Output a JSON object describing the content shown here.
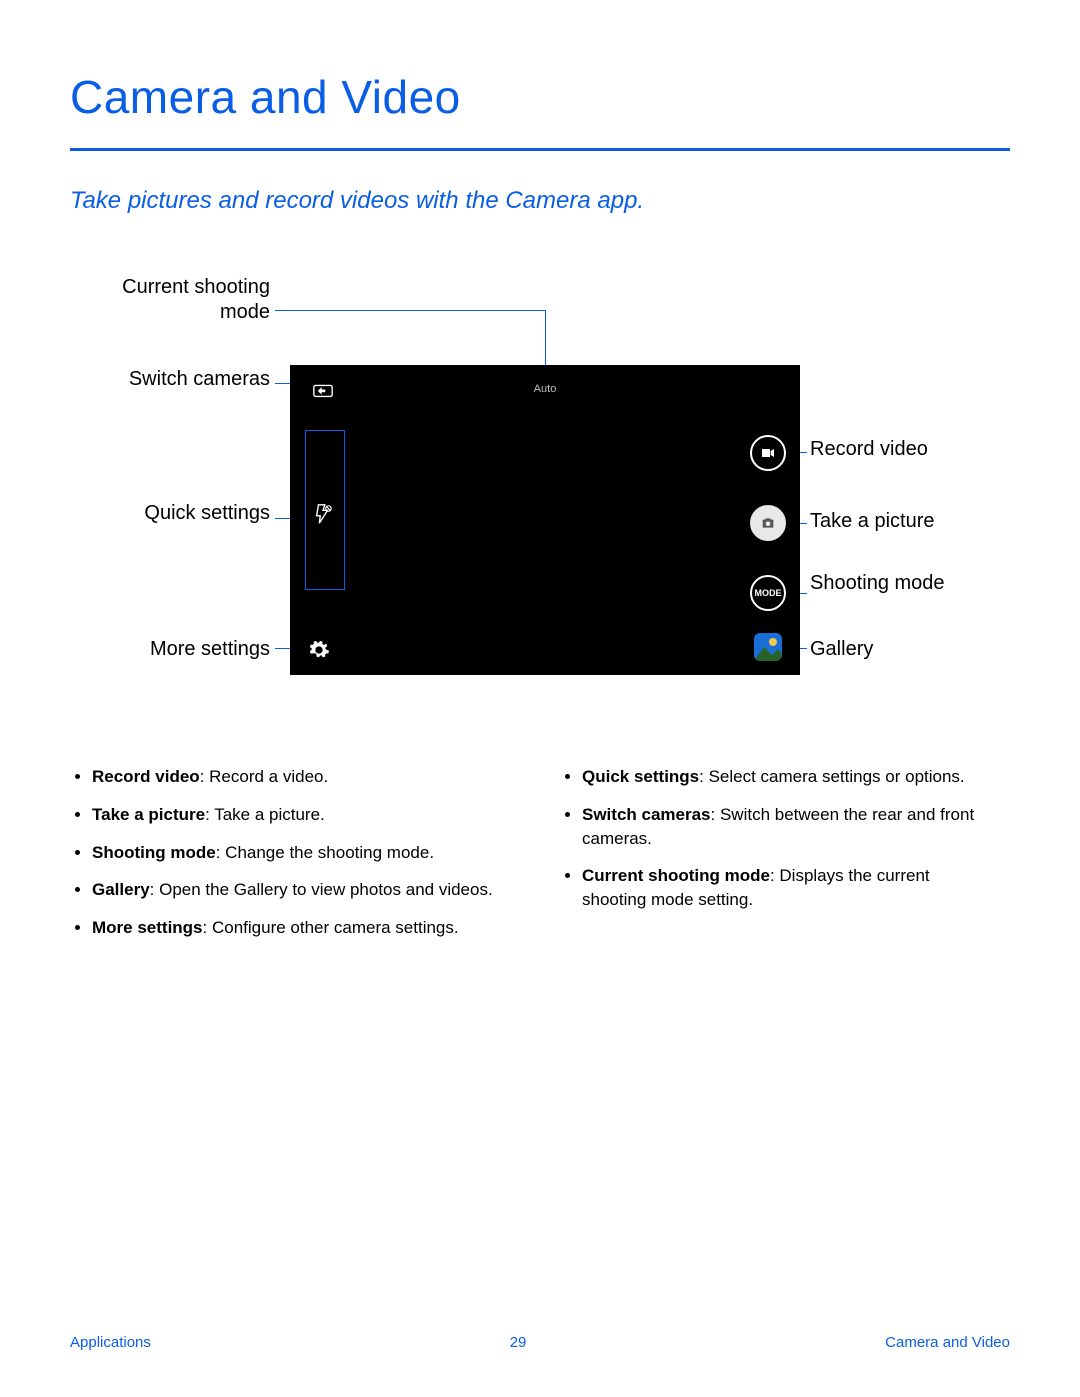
{
  "title": "Camera and Video",
  "subtitle": "Take pictures and record videos with the Camera app.",
  "diagram": {
    "left": {
      "current": "Current shooting mode",
      "switch": "Switch cameras",
      "quick": "Quick settings",
      "more": "More settings"
    },
    "right": {
      "record": "Record video",
      "take": "Take a picture",
      "shootmode": "Shooting mode",
      "gallery": "Gallery"
    },
    "screenshot": {
      "auto": "Auto",
      "modeLabel": "MODE"
    }
  },
  "bullets": {
    "left": [
      {
        "term": "Record video",
        "desc": ": Record a video."
      },
      {
        "term": "Take a picture",
        "desc": ": Take a picture."
      },
      {
        "term": "Shooting mode",
        "desc": ": Change the shooting mode."
      },
      {
        "term": "Gallery",
        "desc": ": Open the Gallery to view photos and videos."
      },
      {
        "term": "More settings",
        "desc": ": Configure other camera settings."
      }
    ],
    "right": [
      {
        "term": "Quick settings",
        "desc": ": Select camera settings or options."
      },
      {
        "term": "Switch cameras",
        "desc": ": Switch between the rear and front cameras."
      },
      {
        "term": "Current shooting mode",
        "desc": ": Displays the current shooting mode setting."
      }
    ]
  },
  "footer": {
    "left": "Applications",
    "page": "29",
    "right": "Camera and Video"
  }
}
